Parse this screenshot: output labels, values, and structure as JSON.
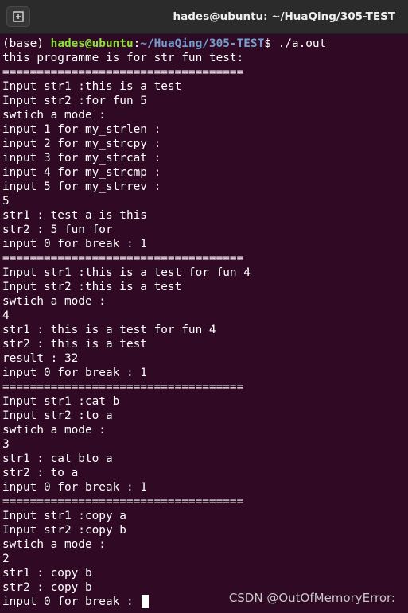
{
  "window": {
    "title": "hades@ubuntu: ~/HuaQing/305-TEST",
    "new_tab_icon": "new-tab-plus-icon"
  },
  "prompt": {
    "env": "(base) ",
    "user_host": "hades@ubuntu",
    "colon": ":",
    "path": "~/HuaQing/305-TEST",
    "dollar": "$ ",
    "command": "./a.out"
  },
  "output_lines": [
    "this programme is for str_fun test:",
    "===================================",
    "Input str1 :this is a test",
    "Input str2 :for fun 5",
    "swtich a mode :",
    "input 1 for my_strlen :",
    "input 2 for my_strcpy :",
    "input 3 for my_strcat :",
    "input 4 for my_strcmp :",
    "input 5 for my_strrev :",
    "5",
    "str1 : test a is this",
    "str2 : 5 fun for",
    "input 0 for break : 1",
    "===================================",
    "Input str1 :this is a test for fun 4",
    "Input str2 :this is a test",
    "swtich a mode :",
    "4",
    "str1 : this is a test for fun 4",
    "str2 : this is a test",
    "result : 32",
    "input 0 for break : 1",
    "===================================",
    "Input str1 :cat b",
    "Input str2 :to a",
    "swtich a mode :",
    "3",
    "str1 : cat bto a",
    "str2 : to a",
    "input 0 for break : 1",
    "===================================",
    "Input str1 :copy a",
    "Input str2 :copy b",
    "swtich a mode :",
    "2",
    "str1 : copy b",
    "str2 : copy b"
  ],
  "last_line": "input 0 for break : ",
  "watermark": "CSDN @OutOfMemoryError:",
  "colors": {
    "background": "#300a24",
    "titlebar": "#2b2b2b",
    "user_host": "#8ae234",
    "path": "#729fcf",
    "text": "#ffffff"
  }
}
